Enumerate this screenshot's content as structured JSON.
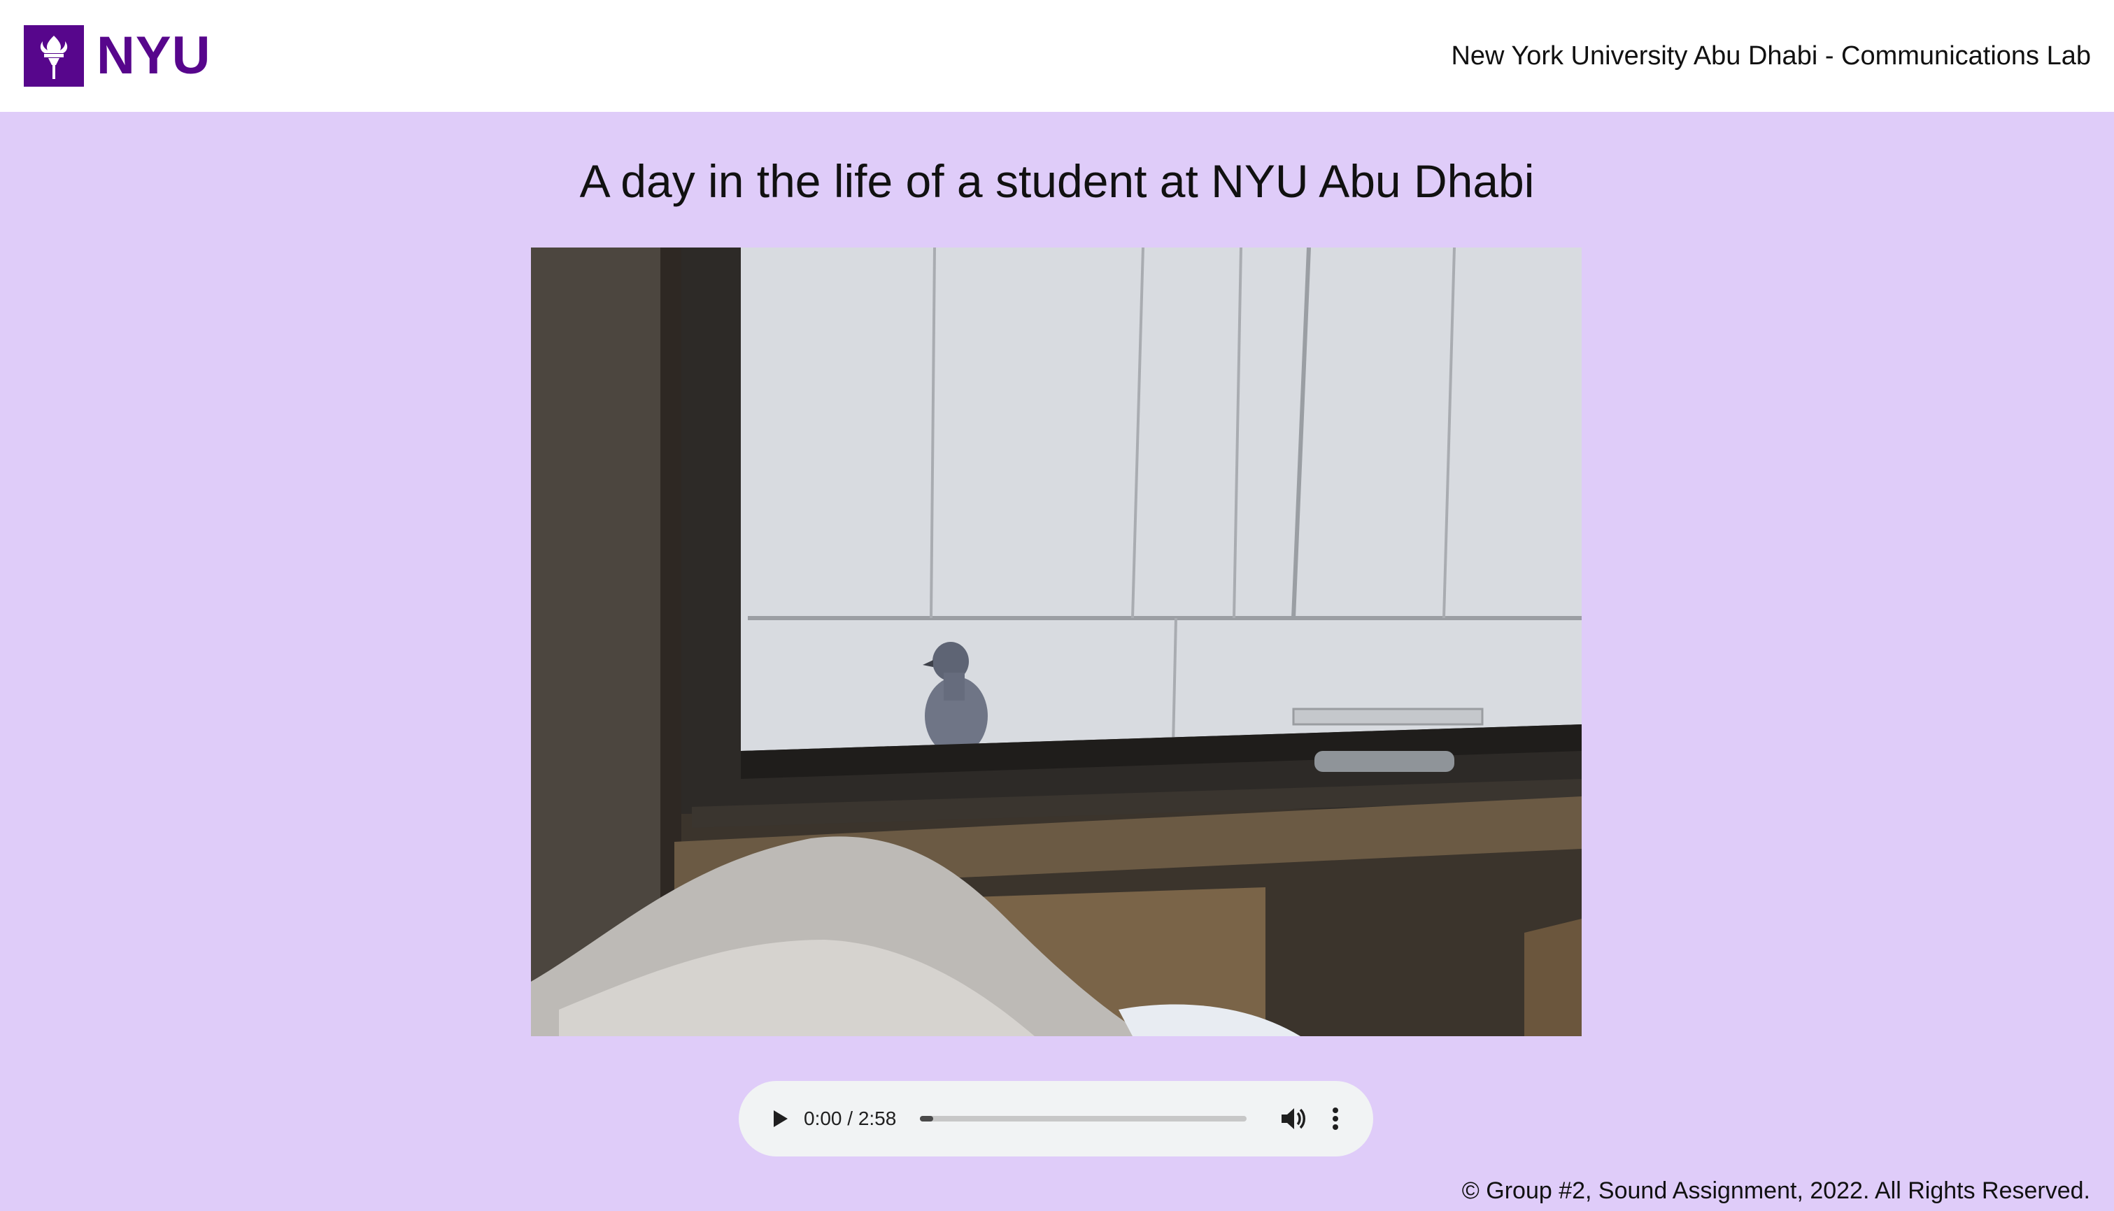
{
  "header": {
    "logo_text": "NYU",
    "title": "New York University Abu Dhabi - Communications Lab"
  },
  "main": {
    "title": "A day in the life of a student at NYU Abu Dhabi"
  },
  "audio_player": {
    "time_display": "0:00 / 2:58",
    "progress_fraction": 0.04
  },
  "footer": {
    "text": "© Group #2, Sound Assignment, 2022. All Rights Reserved."
  },
  "colors": {
    "brand_purple": "#57068c",
    "page_background": "#dfccf9"
  },
  "icons": [
    "torch-icon",
    "play-icon",
    "volume-icon",
    "more-options-icon"
  ]
}
